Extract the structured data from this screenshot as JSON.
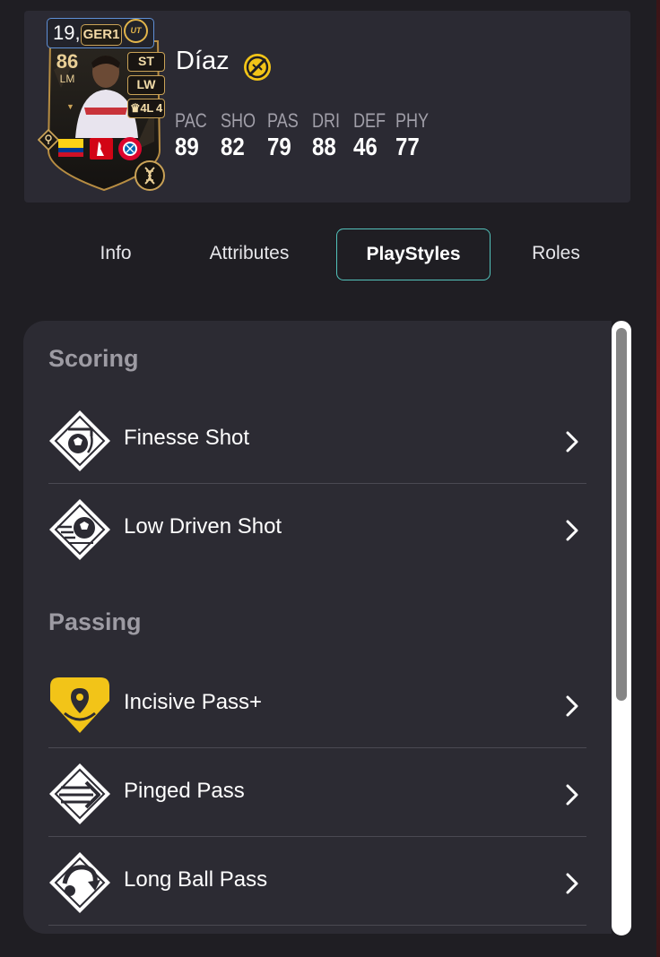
{
  "player": {
    "price": "19,5",
    "league": "GER1",
    "coin": "UT",
    "rating": "86",
    "card_position": "LM",
    "alt_positions": [
      "ST",
      "LW"
    ],
    "skills_weak_foot": "4L 4",
    "name": "Díaz",
    "stats": [
      {
        "label": "PAC",
        "value": "89"
      },
      {
        "label": "SHO",
        "value": "82"
      },
      {
        "label": "PAS",
        "value": "79"
      },
      {
        "label": "DRI",
        "value": "88"
      },
      {
        "label": "DEF",
        "value": "46"
      },
      {
        "label": "PHY",
        "value": "77"
      }
    ]
  },
  "tabs": [
    {
      "label": "Info",
      "active": false
    },
    {
      "label": "Attributes",
      "active": false
    },
    {
      "label": "PlayStyles",
      "active": true
    },
    {
      "label": "Roles",
      "active": false
    }
  ],
  "sections": [
    {
      "title": "Scoring",
      "items": [
        {
          "name": "Finesse Shot",
          "icon": "finesse-shot-icon",
          "plus": false
        },
        {
          "name": "Low Driven Shot",
          "icon": "low-driven-shot-icon",
          "plus": false
        }
      ]
    },
    {
      "title": "Passing",
      "items": [
        {
          "name": "Incisive Pass+",
          "icon": "incisive-pass-plus-icon",
          "plus": true
        },
        {
          "name": "Pinged Pass",
          "icon": "pinged-pass-icon",
          "plus": false
        },
        {
          "name": "Long Ball Pass",
          "icon": "long-ball-pass-icon",
          "plus": false
        }
      ]
    }
  ],
  "colors": {
    "background": "#1f1e23",
    "card": "#2b2a33",
    "panel": "#2c2b33",
    "accent": "#53c2bb",
    "gold": "#f2c418",
    "muted_text": "#9d9ba3"
  }
}
